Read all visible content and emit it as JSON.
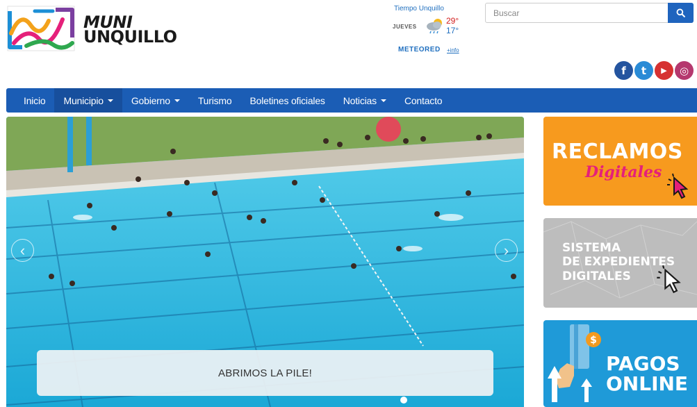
{
  "logo": {
    "line1": "MUNI",
    "line2": "UNQUILLO"
  },
  "weather": {
    "title": "Tiempo Unquillo",
    "day": "JUEVES",
    "high": "29°",
    "low": "17°",
    "brand": "METEORED",
    "info_link": "+info",
    "icon": "partly-cloudy-rain-icon"
  },
  "search": {
    "placeholder": "Buscar",
    "button_icon": "search-icon"
  },
  "social": [
    {
      "name": "facebook",
      "glyph": "f"
    },
    {
      "name": "twitter",
      "glyph": "t"
    },
    {
      "name": "youtube",
      "glyph": "▶"
    },
    {
      "name": "instagram",
      "glyph": "◎"
    }
  ],
  "nav": {
    "items": [
      {
        "label": "Inicio",
        "dropdown": false
      },
      {
        "label": "Municipio",
        "dropdown": true
      },
      {
        "label": "Gobierno",
        "dropdown": true
      },
      {
        "label": "Turismo",
        "dropdown": false
      },
      {
        "label": "Boletines oficiales",
        "dropdown": false
      },
      {
        "label": "Noticias",
        "dropdown": true
      },
      {
        "label": "Contacto",
        "dropdown": false
      }
    ]
  },
  "slider": {
    "caption": "ABRIMOS LA PILE!",
    "prev_glyph": "‹",
    "next_glyph": "›"
  },
  "banners": {
    "reclamos": {
      "title": "RECLAMOS",
      "subtitle": "Digitales"
    },
    "expedientes": {
      "line1": "SISTEMA",
      "line2": "DE EXPEDIENTES",
      "line3": "DIGITALES"
    },
    "pagos": {
      "line1": "PAGOS",
      "line2": "ONLINE"
    }
  },
  "colors": {
    "nav_bg": "#1b5db5",
    "nav_active": "#174f9d",
    "reclamos_bg": "#f79a1e",
    "expedientes_bg": "#bdbdbd",
    "pagos_bg": "#1f9ad8"
  }
}
